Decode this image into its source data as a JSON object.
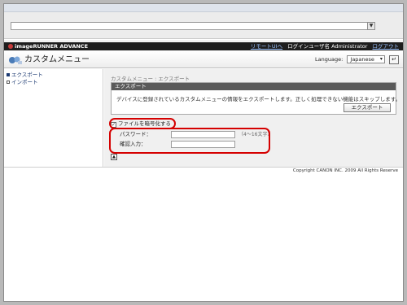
{
  "browser": {
    "address_dropdown_glyph": "▼"
  },
  "header": {
    "brand": "imageRUNNER ADVANCE",
    "remote_ui_link": "リモートUIへ",
    "login_user_label": "ログインユーザ名",
    "user_name": "Administrator",
    "logout_link": "ログアウト"
  },
  "page": {
    "title": "カスタムメニュー",
    "language_label": "Language:",
    "language_value": "Japanese",
    "language_button_glyph": "↵"
  },
  "sidebar": {
    "items": [
      {
        "label": "エクスポート",
        "active": true
      },
      {
        "label": "インポート",
        "active": false
      }
    ]
  },
  "main": {
    "breadcrumb": "カスタムメニュー : エクスポート",
    "panel_title": "エクスポート",
    "description": "デバイスに登録されているカスタムメニューの情報をエクスポートします。正しく処理できない機能はスキップします。",
    "export_button": "エクスポート",
    "encrypt_checkbox_label": "ファイルを暗号化する",
    "encrypt_checked": true,
    "password_label": "パスワード：",
    "password_hint": "（4～16文字）",
    "confirm_label": "確認入力："
  },
  "footer": {
    "copyright": "Copyright CANON INC. 2009 All Rights Reserve"
  },
  "colors": {
    "header_bg": "#1d1d1d",
    "panel_header": "#5a5a5a",
    "highlight": "#d50000"
  }
}
